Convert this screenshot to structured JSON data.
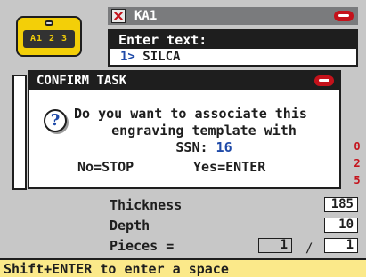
{
  "background": {
    "window_title": "KA1",
    "key_plate_text": "A1 2 3",
    "enter": {
      "header": "Enter text:",
      "item_index": "1>",
      "item_value": "SILCA"
    },
    "right_marks": [
      "0",
      "2",
      "5"
    ],
    "fields": [
      {
        "label": "Thickness",
        "value": "185"
      },
      {
        "label": "Depth",
        "value": "10"
      },
      {
        "label": "Pieces =",
        "value_a": "1",
        "separator": "/",
        "value_b": "1"
      }
    ]
  },
  "dialog": {
    "title": "CONFIRM TASK",
    "message_line1": "Do you want to associate this",
    "message_line2": "engraving template with",
    "ssn_label": "SSN:",
    "ssn_value": "16",
    "option_stop": "No=STOP",
    "option_enter": "Yes=ENTER",
    "question_icon": "question-mark-icon"
  },
  "status_bar": {
    "text": "Shift+ENTER to enter a space"
  },
  "colors": {
    "background": "#c7c7c7",
    "title_bar": "#1e1e1e",
    "accent_blue": "#1f4aa8",
    "brand_red": "#c5121b",
    "status_yellow": "#fbe98a",
    "key_yellow": "#f3cf08"
  }
}
